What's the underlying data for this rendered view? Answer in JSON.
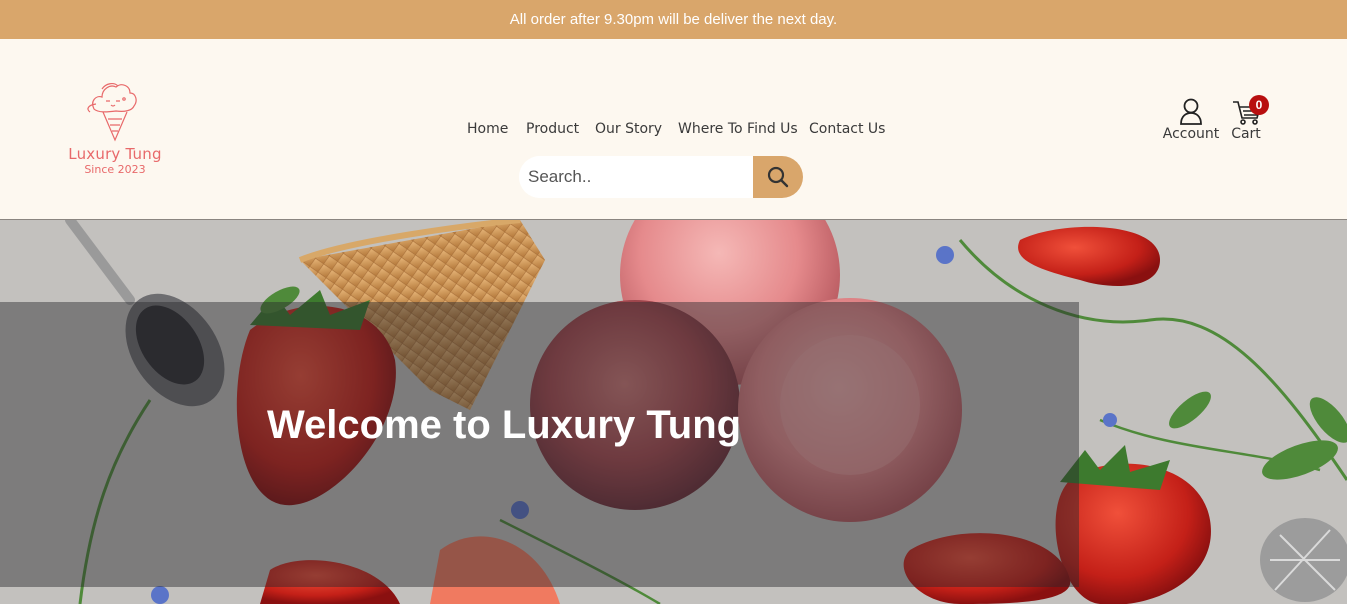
{
  "announcement": "All order after 9.30pm will be deliver the next day.",
  "brand": {
    "name": "Luxury Tung",
    "tagline": "Since 2023"
  },
  "nav": [
    {
      "label": "Home"
    },
    {
      "label": "Product"
    },
    {
      "label": "Our Story"
    },
    {
      "label": "Where To Find Us"
    },
    {
      "label": "Contact Us"
    }
  ],
  "search": {
    "placeholder": "Search..",
    "value": "",
    "icon": "search-icon"
  },
  "account": {
    "label": "Account",
    "icon": "user-icon"
  },
  "cart": {
    "label": "Cart",
    "count": "0",
    "icon": "cart-icon"
  },
  "hero": {
    "heading": "Welcome to Luxury Tung"
  },
  "colors": {
    "accent": "#d9a66b",
    "header_bg": "#fdf8f0",
    "logo": "#e8696a",
    "badge": "#b80f0f"
  }
}
